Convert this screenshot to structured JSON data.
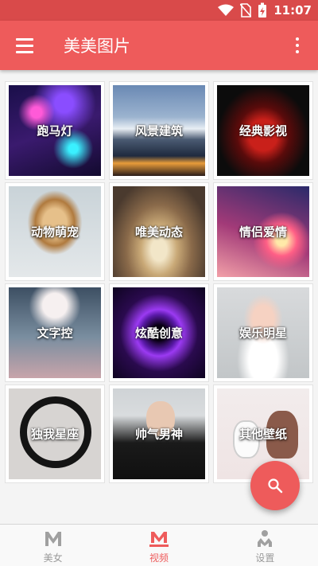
{
  "status_bar": {
    "time": "11:07",
    "icons": [
      "wifi-icon",
      "no-sim-icon",
      "battery-charging-icon"
    ]
  },
  "app_bar": {
    "title": "美美图片",
    "left_icon": "menu-icon",
    "right_icon": "more-vertical-icon",
    "background_color": "#ee5b5b"
  },
  "categories": [
    {
      "label": "跑马灯"
    },
    {
      "label": "风景建筑"
    },
    {
      "label": "经典影视"
    },
    {
      "label": "动物萌宠"
    },
    {
      "label": "唯美动态"
    },
    {
      "label": "情侣爱情"
    },
    {
      "label": "文字控"
    },
    {
      "label": "炫酷创意"
    },
    {
      "label": "娱乐明星"
    },
    {
      "label": "独我星座"
    },
    {
      "label": "帅气男神"
    },
    {
      "label": "其他壁纸"
    }
  ],
  "fab": {
    "icon": "search-icon"
  },
  "bottom_nav": {
    "items": [
      {
        "label": "美女",
        "icon": "m-logo-icon",
        "active": false
      },
      {
        "label": "视频",
        "icon": "m-video-icon",
        "active": true
      },
      {
        "label": "设置",
        "icon": "person-settings-icon",
        "active": false
      }
    ],
    "active_color": "#ee5b5b",
    "inactive_color": "#9a9a9a"
  }
}
